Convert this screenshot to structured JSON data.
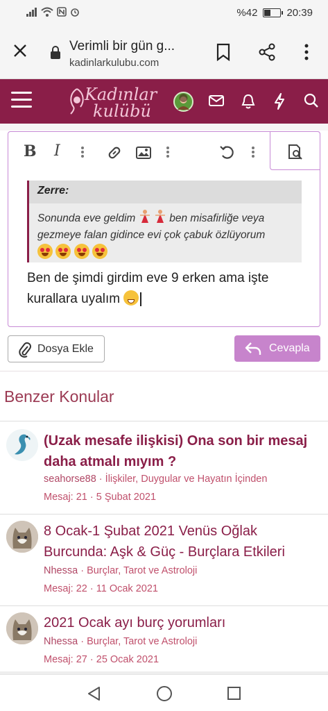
{
  "status": {
    "battery": "%42",
    "battery_level": 0.42,
    "time": "20:39"
  },
  "browser": {
    "page_title": "Verimli bir gün g...",
    "url": "kadinlarkulubu.com"
  },
  "site": {
    "logo_line1": "Kadınlar",
    "logo_line2": "kulübü",
    "brand_color": "#8a1e48"
  },
  "editor": {
    "quote_author": "Zerre:",
    "quote_text_1": "Sonunda eve geldim",
    "quote_text_2": "ben misafirliğe veya gezmeye falan gidince evi çok çabuk özlüyorum",
    "reply_text": "Ben de şimdi girdim eve 9 erken ama işte kurallara uyalım"
  },
  "buttons": {
    "attach": "Dosya Ekle",
    "reply": "Cevapla"
  },
  "similar": {
    "heading": "Benzer Konular",
    "items": [
      {
        "title": "(Uzak mesafe ilişkisi) Ona son bir mesaj daha atmalı mıyım ?",
        "author": "seahorse88",
        "forum": "İlişkiler, Duygular ve Hayatın İçinden",
        "stats": "Mesaj: 21 · 5 Şubat 2021"
      },
      {
        "title": "8 Ocak-1 Şubat 2021 Venüs Oğlak Burcunda: Aşk & Güç - Burçlara Etkileri",
        "author": "Nhessa",
        "forum": "Burçlar, Tarot ve Astroloji",
        "stats": "Mesaj: 22 · 11 Ocak 2021"
      },
      {
        "title": "2021 Ocak ayı burç yorumları",
        "author": "Nhessa",
        "forum": "Burçlar, Tarot ve Astroloji",
        "stats": "Mesaj: 27 · 25 Ocak 2021"
      }
    ]
  }
}
